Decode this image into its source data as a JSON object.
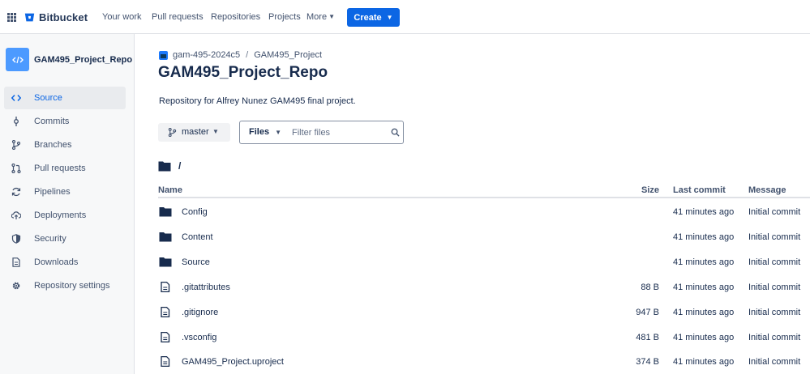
{
  "topnav": {
    "brand": "Bitbucket",
    "items": [
      "Your work",
      "Pull requests",
      "Repositories",
      "Projects"
    ],
    "more_label": "More",
    "create_label": "Create"
  },
  "sidebar": {
    "repo_name": "GAM495_Project_Repo",
    "active_item": "Source",
    "items": [
      {
        "label": "Source",
        "icon": "code-icon"
      },
      {
        "label": "Commits",
        "icon": "commit-icon"
      },
      {
        "label": "Branches",
        "icon": "branch-icon"
      },
      {
        "label": "Pull requests",
        "icon": "pull-request-icon"
      },
      {
        "label": "Pipelines",
        "icon": "pipelines-icon"
      },
      {
        "label": "Deployments",
        "icon": "cloud-upload-icon"
      },
      {
        "label": "Security",
        "icon": "shield-icon"
      },
      {
        "label": "Downloads",
        "icon": "file-icon"
      },
      {
        "label": "Repository settings",
        "icon": "gear-icon"
      }
    ]
  },
  "breadcrumb": {
    "workspace": "gam-495-2024c5",
    "separator": "/",
    "project": "GAM495_Project"
  },
  "repo": {
    "title": "GAM495_Project_Repo",
    "description": "Repository for Alfrey Nunez GAM495 final project."
  },
  "toolbar": {
    "branch": "master",
    "files_label": "Files",
    "filter_placeholder": "Filter files"
  },
  "path": "/",
  "table": {
    "columns": {
      "name": "Name",
      "size": "Size",
      "last_commit": "Last commit",
      "message": "Message"
    },
    "rows": [
      {
        "name": "Config",
        "type": "folder",
        "size": "",
        "last_commit": "41 minutes ago",
        "message": "Initial commit"
      },
      {
        "name": "Content",
        "type": "folder",
        "size": "",
        "last_commit": "41 minutes ago",
        "message": "Initial commit"
      },
      {
        "name": "Source",
        "type": "folder",
        "size": "",
        "last_commit": "41 minutes ago",
        "message": "Initial commit"
      },
      {
        "name": ".gitattributes",
        "type": "file",
        "size": "88 B",
        "last_commit": "41 minutes ago",
        "message": "Initial commit"
      },
      {
        "name": ".gitignore",
        "type": "file",
        "size": "947 B",
        "last_commit": "41 minutes ago",
        "message": "Initial commit"
      },
      {
        "name": ".vsconfig",
        "type": "file",
        "size": "481 B",
        "last_commit": "41 minutes ago",
        "message": "Initial commit"
      },
      {
        "name": "GAM495_Project.uproject",
        "type": "file",
        "size": "374 B",
        "last_commit": "41 minutes ago",
        "message": "Initial commit"
      }
    ]
  },
  "colors": {
    "accent": "#0c66e4",
    "repo_avatar": "#4c9aff",
    "text": "#172b4d",
    "subtle_text": "#42526e",
    "sidebar_bg": "#f7f8f9"
  }
}
